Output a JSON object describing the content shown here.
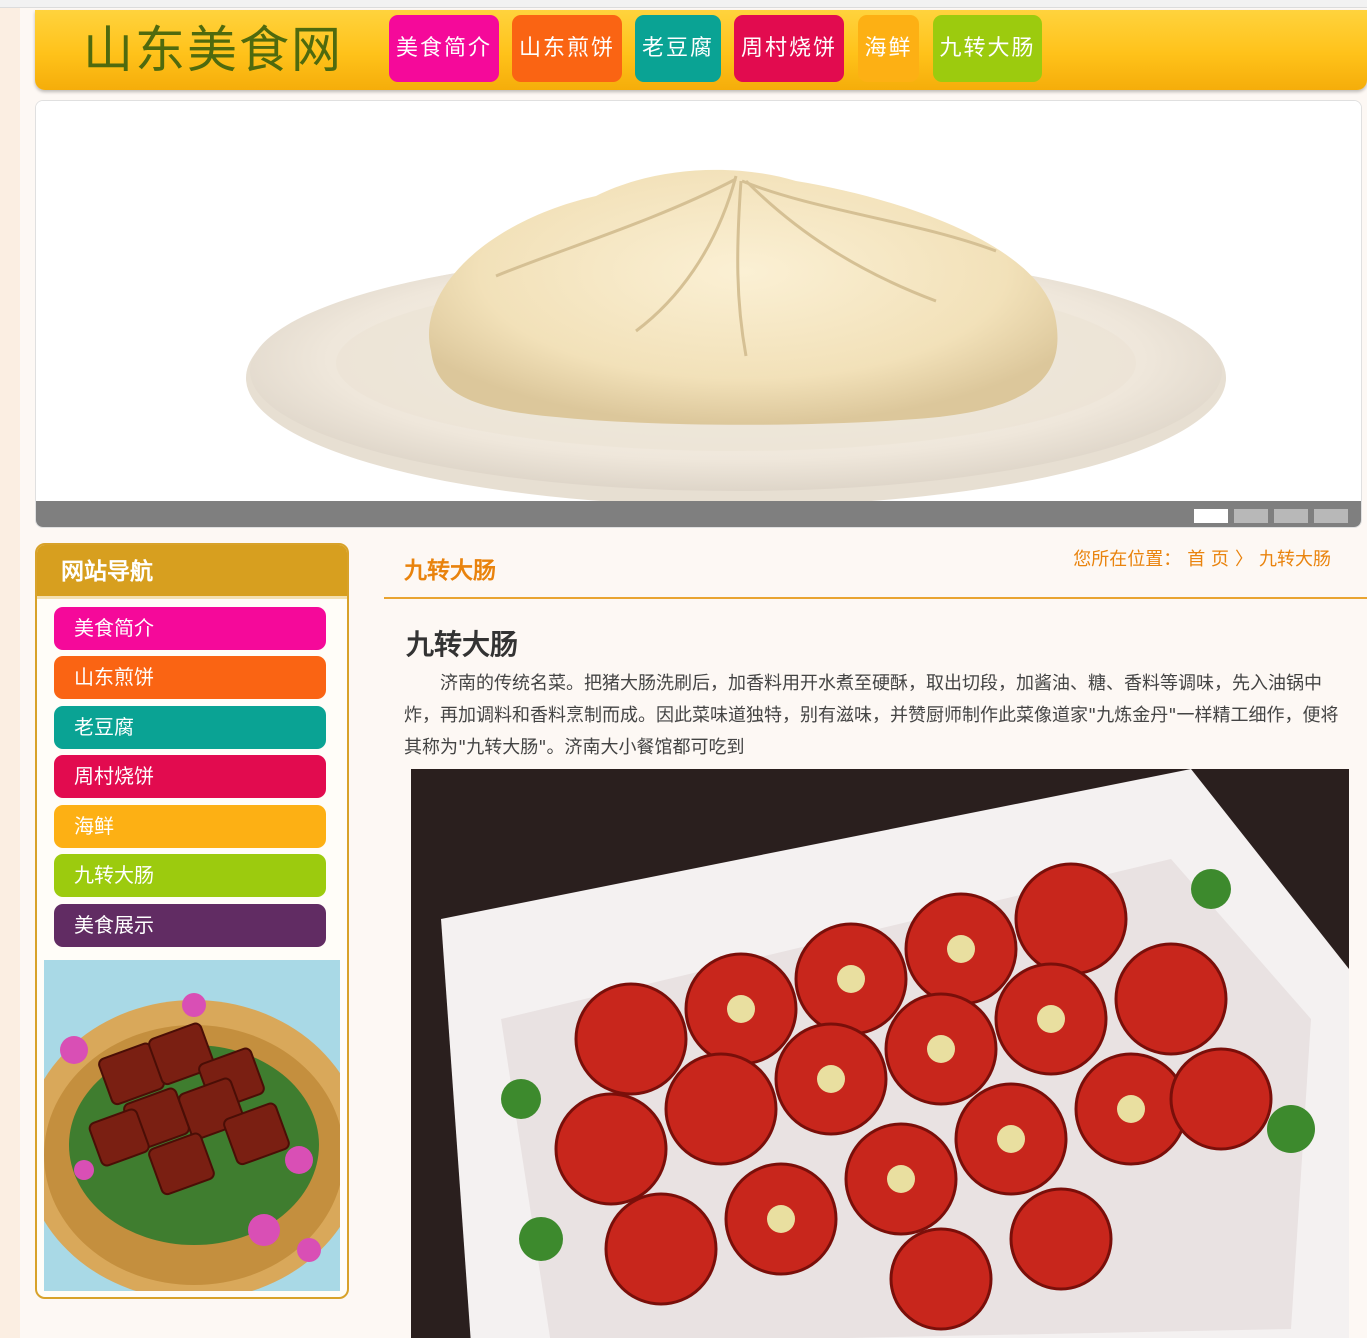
{
  "header": {
    "logo": "山东美食网",
    "nav": [
      {
        "label": "美食简介",
        "color": "#f5099a"
      },
      {
        "label": "山东煎饼",
        "color": "#fa6413"
      },
      {
        "label": "老豆腐",
        "color": "#0aa394"
      },
      {
        "label": "周村烧饼",
        "color": "#e20b4f"
      },
      {
        "label": "海鲜",
        "color": "#fdb014"
      },
      {
        "label": "九转大肠",
        "color": "#9ccb0e"
      }
    ]
  },
  "banner": {
    "image": "steamed-bun-photo",
    "dots": 4,
    "active_dot": 1
  },
  "sidebar": {
    "title": "网站导航",
    "items": [
      {
        "label": "美食简介",
        "color": "#f5099a"
      },
      {
        "label": "山东煎饼",
        "color": "#fa6413"
      },
      {
        "label": "老豆腐",
        "color": "#0aa394"
      },
      {
        "label": "周村烧饼",
        "color": "#e20b4f"
      },
      {
        "label": "海鲜",
        "color": "#fdb014"
      },
      {
        "label": "九转大肠",
        "color": "#9ccb0e"
      },
      {
        "label": "美食展示",
        "color": "#612c63"
      }
    ],
    "photo": "braised-pork-photo"
  },
  "content": {
    "section_title": "九转大肠",
    "breadcrumb": {
      "prefix": "您所在位置：",
      "home": "首 页",
      "separator": "〉",
      "current": "九转大肠"
    },
    "article_title": "九转大肠",
    "article_body": "济南的传统名菜。把猪大肠洗刷后，加香料用开水煮至硬酥，取出切段，加酱油、糖、香料等调味，先入油锅中炸，再加调料和香料烹制而成。因此菜味道独特，别有滋味，并赞厨师制作此菜像道家\"九炼金丹\"一样精工细作，便将其称为\"九转大肠\"。济南大小餐馆都可吃到",
    "photo": "jiuzhuan-dachang-photo"
  },
  "colors": {
    "accent": "#e9830d",
    "header_gold": "#ffc21a",
    "sidebar_gold": "#d79f1f"
  }
}
